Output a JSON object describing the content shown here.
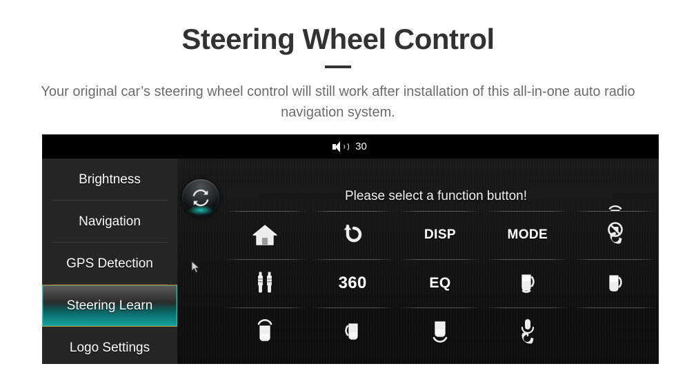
{
  "hero": {
    "title": "Steering Wheel Control",
    "subtitle": "Your original car’s steering wheel control will still work after installation of this all-in-one auto radio navigation system."
  },
  "device": {
    "statusbar": {
      "volume_icon": "speaker-icon",
      "volume_value": "30"
    },
    "sidebar": {
      "items": [
        {
          "label": "Brightness",
          "active": false
        },
        {
          "label": "Navigation",
          "active": false
        },
        {
          "label": "GPS Detection",
          "active": false
        },
        {
          "label": "Steering Learn",
          "active": true
        },
        {
          "label": "Logo Settings",
          "active": false
        }
      ]
    },
    "main": {
      "sync_button_icon": "refresh-sync-icon",
      "instruction": "Please select a function button!",
      "cursor_icon": "mouse-pointer-icon",
      "grid": {
        "columns": 5,
        "partial_top": [
          {
            "icon": "",
            "type": "empty"
          },
          {
            "icon": "",
            "type": "empty"
          },
          {
            "icon": "",
            "type": "empty"
          },
          {
            "icon": "",
            "type": "empty"
          },
          {
            "icon": "car-top-sensor-icon",
            "type": "icon"
          }
        ],
        "rows": [
          [
            {
              "label": "",
              "icon": "home-icon",
              "type": "icon"
            },
            {
              "label": "",
              "icon": "back-arrow-icon",
              "type": "icon"
            },
            {
              "label": "DISP",
              "icon": "",
              "type": "text"
            },
            {
              "label": "MODE",
              "icon": "",
              "type": "text"
            },
            {
              "label": "",
              "icon": "phone-hangup-icon",
              "type": "icon"
            }
          ],
          [
            {
              "label": "",
              "icon": "audio-jack-icon",
              "type": "icon"
            },
            {
              "label": "360",
              "icon": "",
              "type": "text"
            },
            {
              "label": "EQ",
              "icon": "",
              "type": "text"
            },
            {
              "label": "",
              "icon": "car-right-sensor-icon",
              "type": "icon"
            },
            {
              "label": "",
              "icon": "car-right-sensor-icon",
              "type": "icon"
            }
          ],
          [
            {
              "label": "",
              "icon": "car-front-sensor-icon",
              "type": "icon"
            },
            {
              "label": "",
              "icon": "car-left-sensor-icon",
              "type": "icon"
            },
            {
              "label": "",
              "icon": "car-rear-sensor-icon",
              "type": "icon"
            },
            {
              "label": "",
              "icon": "mic-call-icon",
              "type": "icon"
            },
            {
              "label": "",
              "icon": "",
              "type": "empty"
            }
          ]
        ]
      }
    }
  },
  "colors": {
    "title": "#323232",
    "subtitle": "#6b6b6b",
    "screen_bg": "#141414",
    "sidebar_bg": "#262626",
    "accent_teal": "#13a39c",
    "accent_orange": "#d08a2a"
  }
}
